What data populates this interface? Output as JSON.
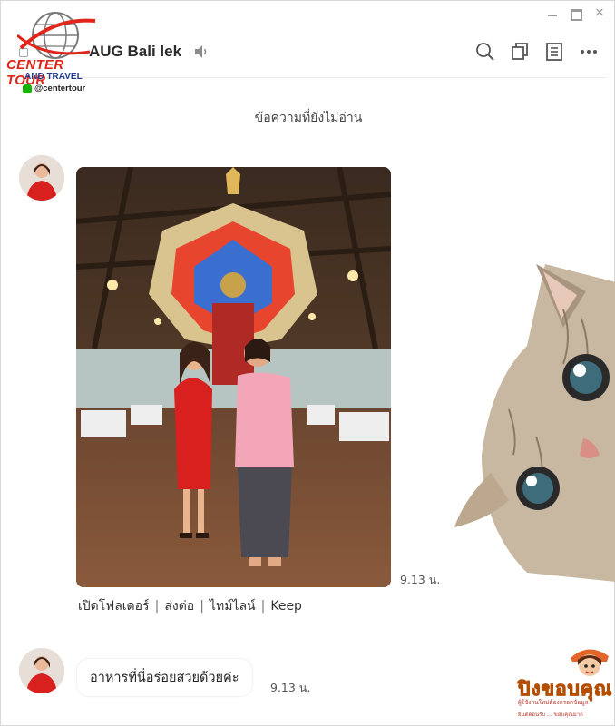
{
  "window": {
    "controls": [
      "minimize",
      "maximize",
      "close"
    ]
  },
  "logo": {
    "line1": "CENTER TOUR",
    "line2": "AND TRAVEL",
    "handle": "@centertour"
  },
  "header": {
    "title": "AUG Bali lek",
    "icons": [
      "speaker-icon",
      "search-icon",
      "copy-icon",
      "notes-icon",
      "more-icon"
    ]
  },
  "divider": {
    "unread_label": "ข้อความที่ยังไม่อ่าน"
  },
  "messages": [
    {
      "type": "image",
      "time": "9.13 น.",
      "actions": [
        "เปิดโฟลเดอร์",
        "ส่งต่อ",
        "ไทม์ไลน์",
        "Keep"
      ]
    },
    {
      "type": "text",
      "text": "อาหารที่นี่อร่อยสวยด้วยค่ะ",
      "time": "9.13 น."
    }
  ],
  "sticker": {
    "title": "ปิงขอบคุณ",
    "line1": "ผู้ใช้งานใหม่ต้องกรอกข้อมูล",
    "line2": "ยินดีต้อนรับ ... ขอบคุณมาก"
  },
  "colors": {
    "logo_red": "#e0261b",
    "logo_blue": "#1f3d8a",
    "line_green": "#18b300",
    "dress_red": "#d8201f"
  }
}
